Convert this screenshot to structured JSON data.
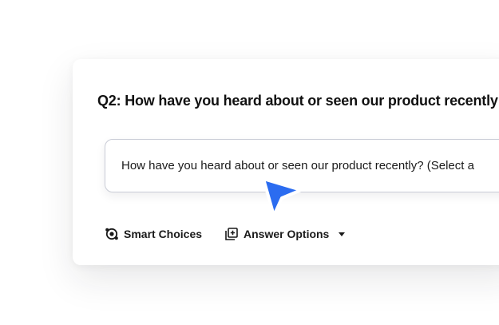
{
  "question": {
    "title": "Q2: How have you heard about or seen our product recently",
    "answer_text": "How have you heard about or seen our product recently? (Select a"
  },
  "toolbar": {
    "smart_choices_label": "Smart Choices",
    "answer_options_label": "Answer Options"
  },
  "icons": {
    "smart_choices": "smart-choices-icon",
    "answer_options": "add-box-icon",
    "dropdown": "caret-down-icon",
    "cursor": "pointer-cursor-icon"
  },
  "colors": {
    "cursor_fill": "#2b6cf0",
    "text": "#1a1a1a"
  }
}
